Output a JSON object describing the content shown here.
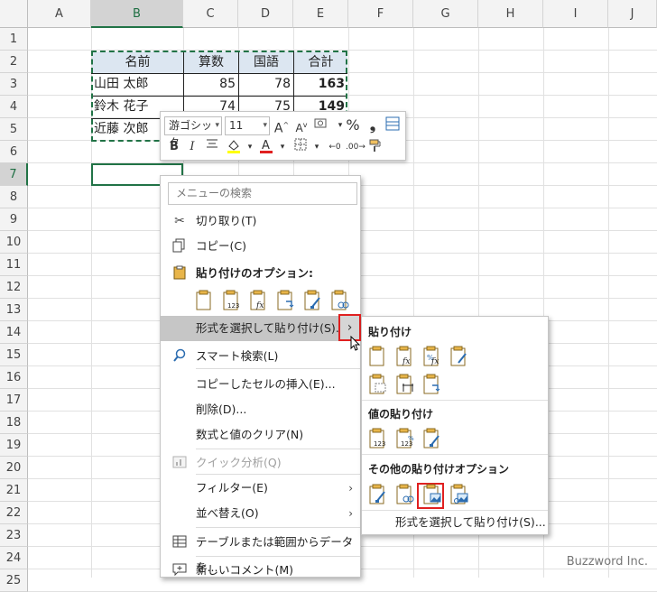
{
  "columns": [
    "A",
    "B",
    "C",
    "D",
    "E",
    "F",
    "G",
    "H",
    "I",
    "J"
  ],
  "rows": [
    "1",
    "2",
    "3",
    "4",
    "5",
    "6",
    "7",
    "8",
    "9",
    "10",
    "11",
    "12",
    "13",
    "14",
    "15",
    "16",
    "17",
    "18",
    "19",
    "20",
    "21",
    "22",
    "23",
    "24",
    "25"
  ],
  "table": {
    "headers": [
      "名前",
      "算数",
      "国語",
      "合計"
    ],
    "rows": [
      {
        "name": "山田 太郎",
        "math": "85",
        "lang": "78",
        "total": "163"
      },
      {
        "name": "鈴木 花子",
        "math": "74",
        "lang": "75",
        "total": "149"
      },
      {
        "name": "近藤 次郎"
      }
    ]
  },
  "mini_toolbar": {
    "font_name": "游ゴシック",
    "font_size": "11",
    "bold": "B",
    "italic": "I",
    "percent": "%",
    "comma": "❟"
  },
  "context_menu": {
    "search_placeholder": "メニューの検索",
    "cut": "切り取り(T)",
    "copy": "コピー(C)",
    "paste_options": "貼り付けのオプション:",
    "paste_special": "形式を選択して貼り付け(S)...",
    "smart_lookup": "スマート検索(L)",
    "insert_copied": "コピーしたセルの挿入(E)...",
    "delete": "削除(D)...",
    "clear": "数式と値のクリア(N)",
    "quick_analysis": "クイック分析(Q)",
    "filter": "フィルター(E)",
    "sort": "並べ替え(O)",
    "table_from_range": "テーブルまたは範囲からデータを...",
    "new_comment": "新しいコメント(M)"
  },
  "submenu": {
    "paste_head": "貼り付け",
    "values_head": "値の貼り付け",
    "other_head": "その他の貼り付けオプション",
    "paste_special": "形式を選択して貼り付け(S)..."
  },
  "watermark": "Buzzword Inc.",
  "colors": {
    "accent": "#217346",
    "highlight": "#e02020",
    "header_fill": "#dce6f1"
  }
}
